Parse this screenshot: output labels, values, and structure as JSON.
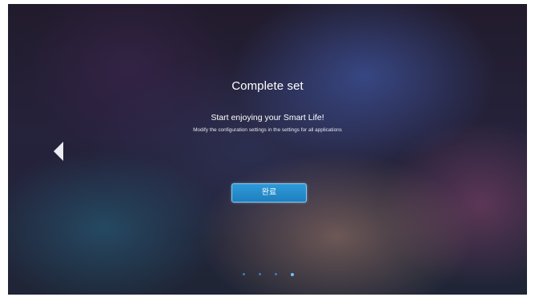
{
  "screen": {
    "title": "Complete set",
    "subtitle": "Start enjoying your Smart Life!",
    "description": "Modify the configuration settings in the settings for all applications"
  },
  "navigation": {
    "back_icon": "chevron-left-icon"
  },
  "actions": {
    "done_label": "완료"
  },
  "pagination": {
    "total_pages": 4,
    "current_page": 4
  },
  "colors": {
    "button": "#2b90cf",
    "button_border": "#8fc8f0",
    "dot": "#3d7fb7",
    "dot_active": "#6fc3ff"
  }
}
